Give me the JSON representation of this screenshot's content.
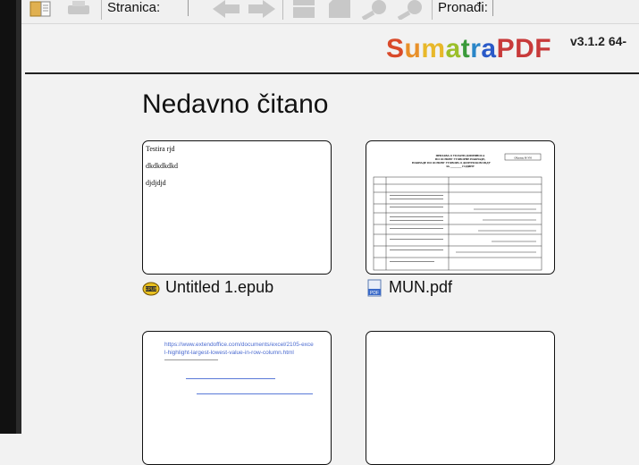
{
  "toolbar": {
    "page_label": "Stranica:",
    "find_label": "Pronađi:"
  },
  "header": {
    "logo_parts": [
      "S",
      "u",
      "m",
      "a",
      "t",
      "r",
      "a",
      "PDF"
    ],
    "logo_colors": [
      "#d94a2a",
      "#e8902a",
      "#e8b82a",
      "#9bbf2a",
      "#3a9a3a",
      "#2a86c8",
      "#2a5ac8",
      "#c83a3a"
    ],
    "version": "v3.1.2 64-"
  },
  "main": {
    "heading": "Nedavno čitano",
    "documents": [
      {
        "name": "Untitled 1.epub",
        "icon": "epub-file-icon",
        "preview_lines": [
          "Testira rjd",
          "dkdkdkdkd",
          "djdjdjd"
        ]
      },
      {
        "name": "MUN.pdf",
        "icon": "pdf-file-icon",
        "preview_title": [
          "ПРИЈАВА О УПЛАТИ ДОПРИНОСА",
          "ПО ОСНОВУ УГОВОРНЕ НАКНАДЕ,",
          "НАКНАДЕ ПО ОСНОВУ УГОВОРА О ДОПУНСКОМ РАДУ",
          "ЗА ________ ГОДИНУ"
        ],
        "preview_form": "Образац М-УН"
      },
      {
        "name": "",
        "icon": "",
        "preview_links": [
          "https://www.extendoffice.com/documents/excel/2105-excel-highlight-largest-lowest-value-in-row-column.html"
        ]
      },
      {
        "name": "",
        "icon": ""
      }
    ]
  }
}
